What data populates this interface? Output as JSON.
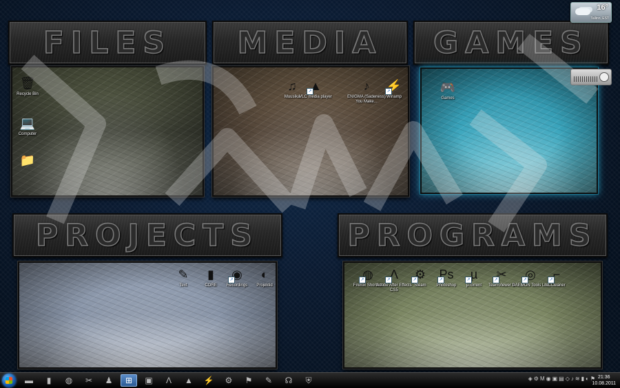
{
  "groups": [
    {
      "id": "files",
      "title": "FILES",
      "icons": [
        {
          "label": "Recycle Bin",
          "icon": "recycle-bin-icon",
          "glyph": "🗑",
          "shortcut": false
        },
        {
          "label": "Computer",
          "icon": "computer-icon",
          "glyph": "💻",
          "shortcut": false
        },
        {
          "label": "",
          "icon": "folder-icon",
          "glyph": "📁",
          "shortcut": false
        }
      ]
    },
    {
      "id": "media",
      "title": "MEDIA",
      "icons": [
        {
          "label": "Muusika",
          "icon": "music-icon",
          "glyph": "♫",
          "shortcut": false
        },
        {
          "label": "VLC media player",
          "icon": "vlc-icon",
          "glyph": "▲",
          "shortcut": true
        },
        {
          "label": "ENIGMA (Sadeness) You Make...",
          "icon": "audio-file-icon",
          "glyph": "♪",
          "shortcut": false
        },
        {
          "label": "Winamp",
          "icon": "winamp-icon",
          "glyph": "⚡",
          "shortcut": true
        }
      ]
    },
    {
      "id": "games",
      "title": "GAMES",
      "icons": [
        {
          "label": "Games",
          "icon": "gamepad-icon",
          "glyph": "🎮",
          "shortcut": false
        }
      ]
    },
    {
      "id": "projects",
      "title": "PROJECTS",
      "icons": [
        {
          "label": "Text",
          "icon": "pencil-icon",
          "glyph": "✎",
          "shortcut": false
        },
        {
          "label": "CORE",
          "icon": "bookmark-icon",
          "glyph": "▮",
          "shortcut": false
        },
        {
          "label": "Recordings",
          "icon": "recordings-icon",
          "glyph": "◉",
          "shortcut": true
        },
        {
          "label": "Projektid",
          "icon": "projects-icon",
          "glyph": "◐",
          "shortcut": false
        }
      ]
    },
    {
      "id": "programs",
      "title": "PROGRAMS",
      "icons": [
        {
          "label": "Firefox Shortcut",
          "icon": "firefox-icon",
          "glyph": "◍",
          "shortcut": true
        },
        {
          "label": "Adobe After Effects CS5",
          "icon": "after-effects-icon",
          "glyph": "Λ",
          "shortcut": true
        },
        {
          "label": "Steam",
          "icon": "steam-icon",
          "glyph": "⚙",
          "shortcut": true
        },
        {
          "label": "Photoshop",
          "icon": "photoshop-icon",
          "glyph": "Ps",
          "shortcut": true
        },
        {
          "label": "µTorrent",
          "icon": "utorrent-icon",
          "glyph": "µ",
          "shortcut": true
        },
        {
          "label": "TeamViewer 6",
          "icon": "teamviewer-icon",
          "glyph": "✂",
          "shortcut": true
        },
        {
          "label": "DAEMON Tools Lite",
          "icon": "daemon-tools-icon",
          "glyph": "◎",
          "shortcut": true
        },
        {
          "label": "CCleaner",
          "icon": "ccleaner-icon",
          "glyph": "⌐",
          "shortcut": true
        }
      ]
    }
  ],
  "weather": {
    "temp": "16°",
    "location": "Tallinn, EST"
  },
  "taskbar": {
    "items": [
      {
        "icon": "folder-icon",
        "glyph": "▬"
      },
      {
        "icon": "bookmark-icon",
        "glyph": "▮"
      },
      {
        "icon": "firefox-icon",
        "glyph": "◍"
      },
      {
        "icon": "wrench-icon",
        "glyph": "✂"
      },
      {
        "icon": "brush-icon",
        "glyph": "♟"
      },
      {
        "icon": "windows-explorer-icon",
        "glyph": "⊞",
        "active": true
      },
      {
        "icon": "winamp-skin-icon",
        "glyph": "▣"
      },
      {
        "icon": "after-effects-icon",
        "glyph": "Λ"
      },
      {
        "icon": "vlc-icon",
        "glyph": "▲"
      },
      {
        "icon": "winamp-icon",
        "glyph": "⚡"
      },
      {
        "icon": "steam-icon",
        "glyph": "⚙"
      },
      {
        "icon": "flag-icon",
        "glyph": "⚑"
      },
      {
        "icon": "notepad-icon",
        "glyph": "✎"
      },
      {
        "icon": "headphones-icon",
        "glyph": "☊"
      },
      {
        "icon": "shield-icon",
        "glyph": "⛨"
      }
    ],
    "tray_glyphs": [
      "◈",
      "⚙",
      "M",
      "◉",
      "▣",
      "▤",
      "◇",
      "♪",
      "≋",
      "▮",
      "◐",
      "⚑"
    ],
    "time": "21:36",
    "date": "10.08.2011"
  }
}
